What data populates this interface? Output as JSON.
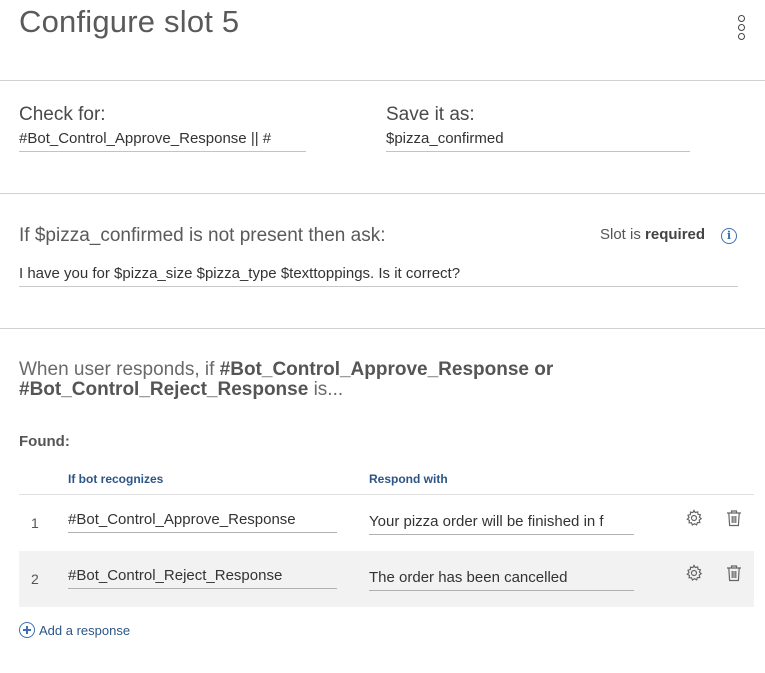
{
  "header": {
    "title": "Configure slot 5",
    "menu_icon": "overflow-menu-icon"
  },
  "check_for": {
    "label": "Check for:",
    "value": "#Bot_Control_Approve_Response || #"
  },
  "save_as": {
    "label": "Save it as:",
    "value": "$pizza_confirmed"
  },
  "prompt": {
    "label": "If $pizza_confirmed is not present then ask:",
    "slot_status_prefix": "Slot is",
    "slot_status_value": "required",
    "info_glyph": "i",
    "value": "I have you for $pizza_size $pizza_type $texttoppings. Is it correct?"
  },
  "handlers": {
    "when_prefix": "When user responds, if",
    "condition_a": "#Bot_Control_Approve_Response",
    "or_word": "or",
    "condition_b": "#Bot_Control_Reject_Response",
    "suffix": "is...",
    "found_label": "Found:",
    "col_recognizes": "If bot recognizes",
    "col_respond": "Respond with",
    "rows": [
      {
        "num": "1",
        "recognizes": "#Bot_Control_Approve_Response",
        "respond": "Your pizza order will be finished in f"
      },
      {
        "num": "2",
        "recognizes": "#Bot_Control_Reject_Response",
        "respond": "The order has been cancelled"
      }
    ],
    "add_label": "Add a response"
  }
}
